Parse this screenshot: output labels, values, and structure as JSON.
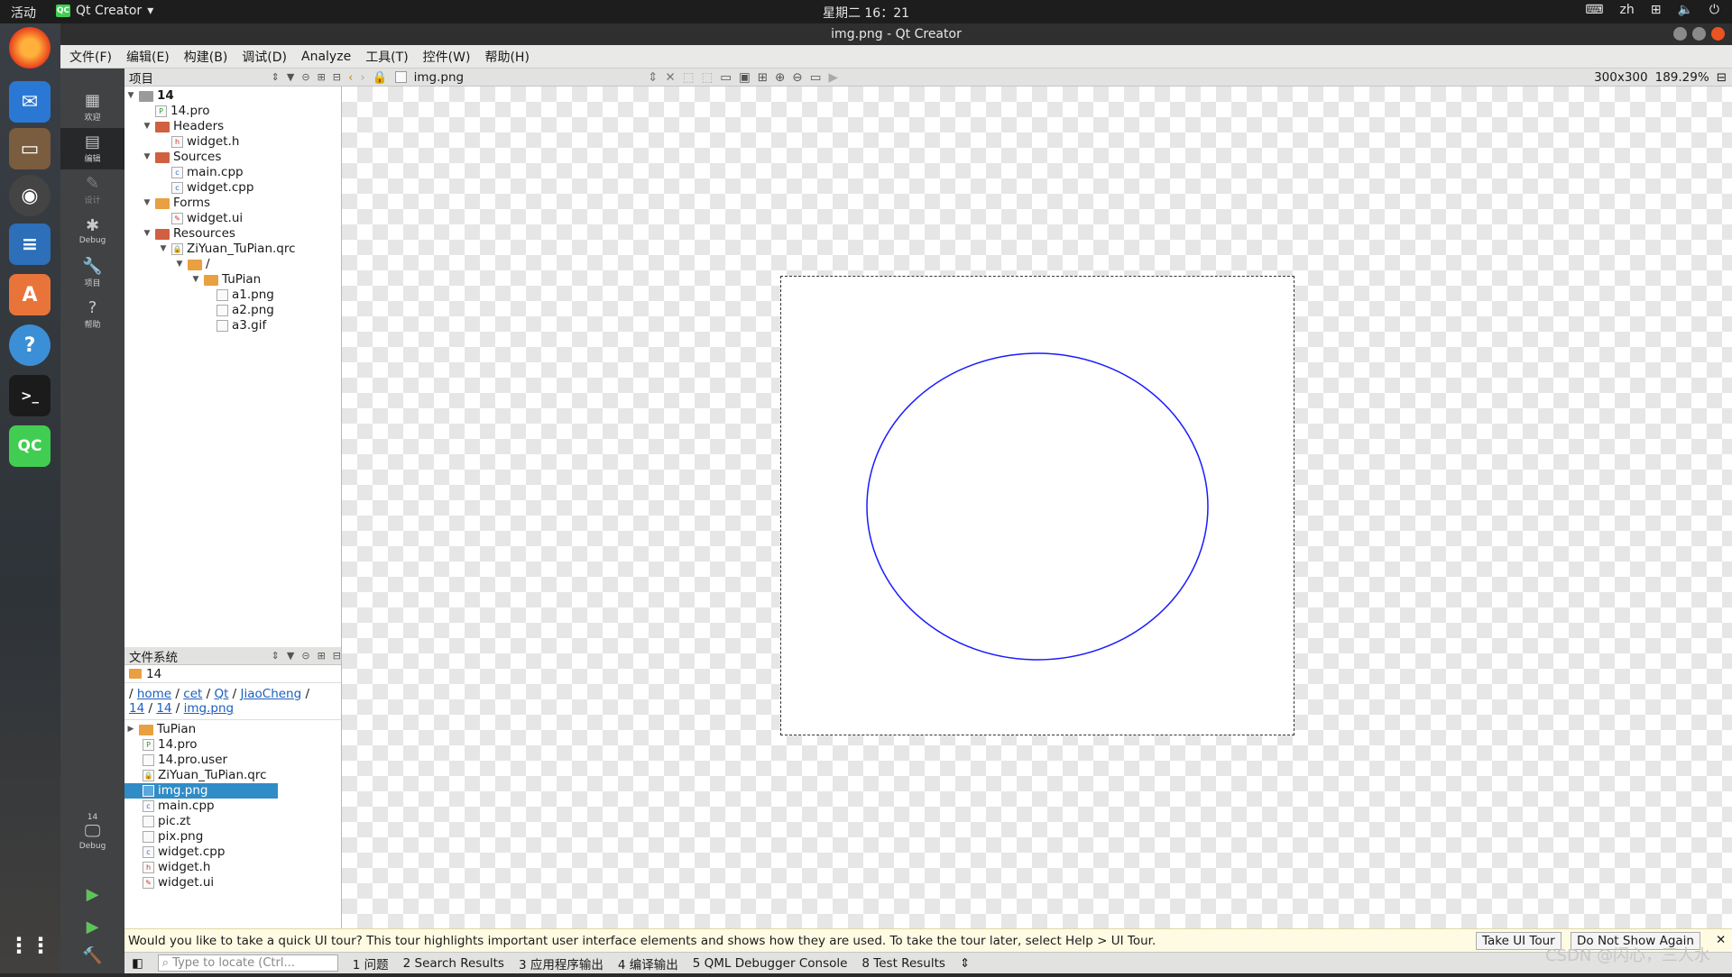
{
  "topbar": {
    "activities": "活动",
    "app_name": "Qt Creator",
    "clock": "星期二 16：21",
    "lang": "zh"
  },
  "window": {
    "title": "img.png - Qt Creator"
  },
  "menu": [
    "文件(F)",
    "编辑(E)",
    "构建(B)",
    "调试(D)",
    "Analyze",
    "工具(T)",
    "控件(W)",
    "帮助(H)"
  ],
  "modes": {
    "welcome": "欢迎",
    "edit": "编辑",
    "design": "设计",
    "debug": "Debug",
    "projects": "项目",
    "help": "帮助",
    "kit_project": "14",
    "kit_debug": "Debug"
  },
  "projects_panel": {
    "title": "项目",
    "tree": [
      {
        "label": "14",
        "bold": true
      },
      {
        "label": "14.pro"
      },
      {
        "label": "Headers"
      },
      {
        "label": "widget.h"
      },
      {
        "label": "Sources"
      },
      {
        "label": "main.cpp"
      },
      {
        "label": "widget.cpp"
      },
      {
        "label": "Forms"
      },
      {
        "label": "widget.ui"
      },
      {
        "label": "Resources"
      },
      {
        "label": "ZiYuan_TuPian.qrc"
      },
      {
        "label": "/"
      },
      {
        "label": "TuPian"
      },
      {
        "label": "a1.png"
      },
      {
        "label": "a2.png"
      },
      {
        "label": "a3.gif"
      }
    ]
  },
  "fs_panel": {
    "title": "文件系统",
    "folder": "14",
    "path": [
      "home",
      "cet",
      "Qt",
      "JiaoCheng",
      "14",
      "14",
      "img.png"
    ],
    "files": [
      "TuPian",
      "14.pro",
      "14.pro.user",
      "ZiYuan_TuPian.qrc",
      "img.png",
      "main.cpp",
      "pic.zt",
      "pix.png",
      "widget.cpp",
      "widget.h",
      "widget.ui"
    ],
    "selected": "img.png"
  },
  "editor": {
    "filename": "img.png",
    "size": "300x300",
    "zoom": "189.29%"
  },
  "image": {
    "stroke_color": "#1a1aff"
  },
  "notice": {
    "text": "Would you like to take a quick UI tour? This tour highlights important user interface elements and shows how they are used. To take the tour later, select Help > UI Tour.",
    "take_tour": "Take UI Tour",
    "dont_show": "Do Not Show Again"
  },
  "statusbar": {
    "locator_placeholder": "Type to locate (Ctrl...",
    "tabs": [
      "1 问题",
      "2 Search Results",
      "3 应用程序输出",
      "4 编译输出",
      "5 QML Debugger Console",
      "8 Test Results"
    ]
  },
  "watermark": "CSDN @闪心，三人水"
}
